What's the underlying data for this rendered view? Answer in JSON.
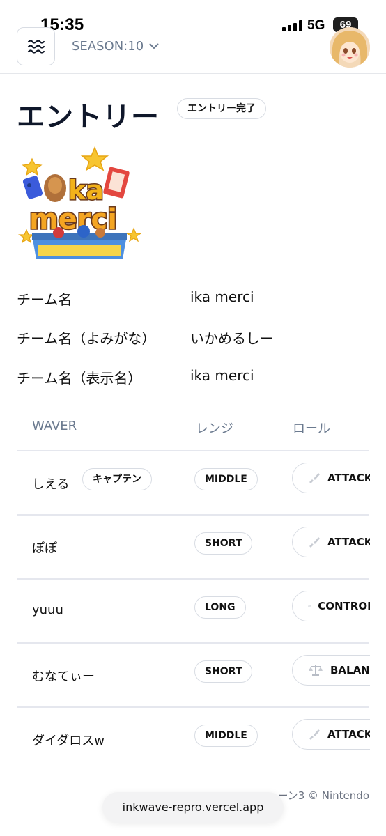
{
  "status_bar": {
    "time": "15:35",
    "network": "5G",
    "battery": "69"
  },
  "header": {
    "season_label": "SEASON:10"
  },
  "page": {
    "title": "エントリー",
    "status_badge": "エントリー完了"
  },
  "team_logo": {
    "text": "ika merci"
  },
  "team_info": [
    {
      "label": "チーム名",
      "value": "ika merci"
    },
    {
      "label": "チーム名（よみがな）",
      "value": "いかめるしー"
    },
    {
      "label": "チーム名（表示名）",
      "value": "ika merci"
    }
  ],
  "table": {
    "headers": [
      "WAVER",
      "レンジ",
      "ロール"
    ],
    "captain_badge": "キャプテン",
    "rows": [
      {
        "name": "しえる",
        "range": "MIDDLE",
        "role": "ATTACKER",
        "role_icon": "sword-icon",
        "captain": true
      },
      {
        "name": "ぽぽ",
        "range": "SHORT",
        "role": "ATTACKER",
        "role_icon": "sword-icon",
        "captain": false
      },
      {
        "name": "yuuu",
        "range": "LONG",
        "role": "CONTROLLER",
        "role_icon": "controller-icon",
        "captain": false
      },
      {
        "name": "むなてぃー",
        "range": "SHORT",
        "role": "BALANCER",
        "role_icon": "scale-icon",
        "captain": false
      },
      {
        "name": "ダイダロスw",
        "range": "MIDDLE",
        "role": "ATTACKER",
        "role_icon": "sword-icon",
        "captain": false
      }
    ]
  },
  "footer": {
    "copyright_visible": "ーン3 © Nintendo",
    "url": "inkwave-repro.vercel.app"
  }
}
